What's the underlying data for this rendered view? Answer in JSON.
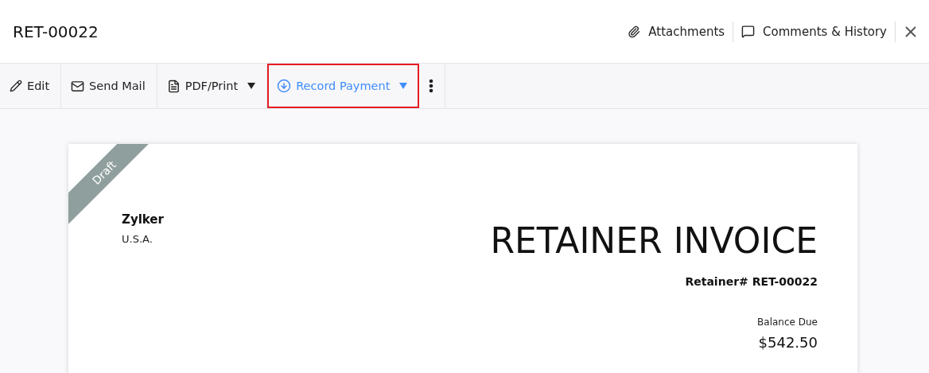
{
  "header": {
    "title": "RET-00022",
    "actions": [
      {
        "kind": "attachments",
        "label": "Attachments"
      },
      {
        "kind": "comments",
        "label": "Comments & History"
      }
    ]
  },
  "toolbar": [
    {
      "kind": "edit",
      "label": "Edit",
      "dropdown": false,
      "highlighted": false
    },
    {
      "kind": "mail",
      "label": "Send Mail",
      "dropdown": false,
      "highlighted": false
    },
    {
      "kind": "pdf",
      "label": "PDF/Print",
      "dropdown": true,
      "highlighted": false
    },
    {
      "kind": "payment",
      "label": "Record Payment",
      "dropdown": true,
      "highlighted": true
    },
    {
      "kind": "more",
      "dropdown": false,
      "highlighted": false
    }
  ],
  "document": {
    "ribbon": "Draft",
    "company": "Zylker",
    "country": "U.S.A.",
    "title": "RETAINER INVOICE",
    "number": "Retainer# RET-00022",
    "balance_label": "Balance Due",
    "balance": "$542.50"
  }
}
